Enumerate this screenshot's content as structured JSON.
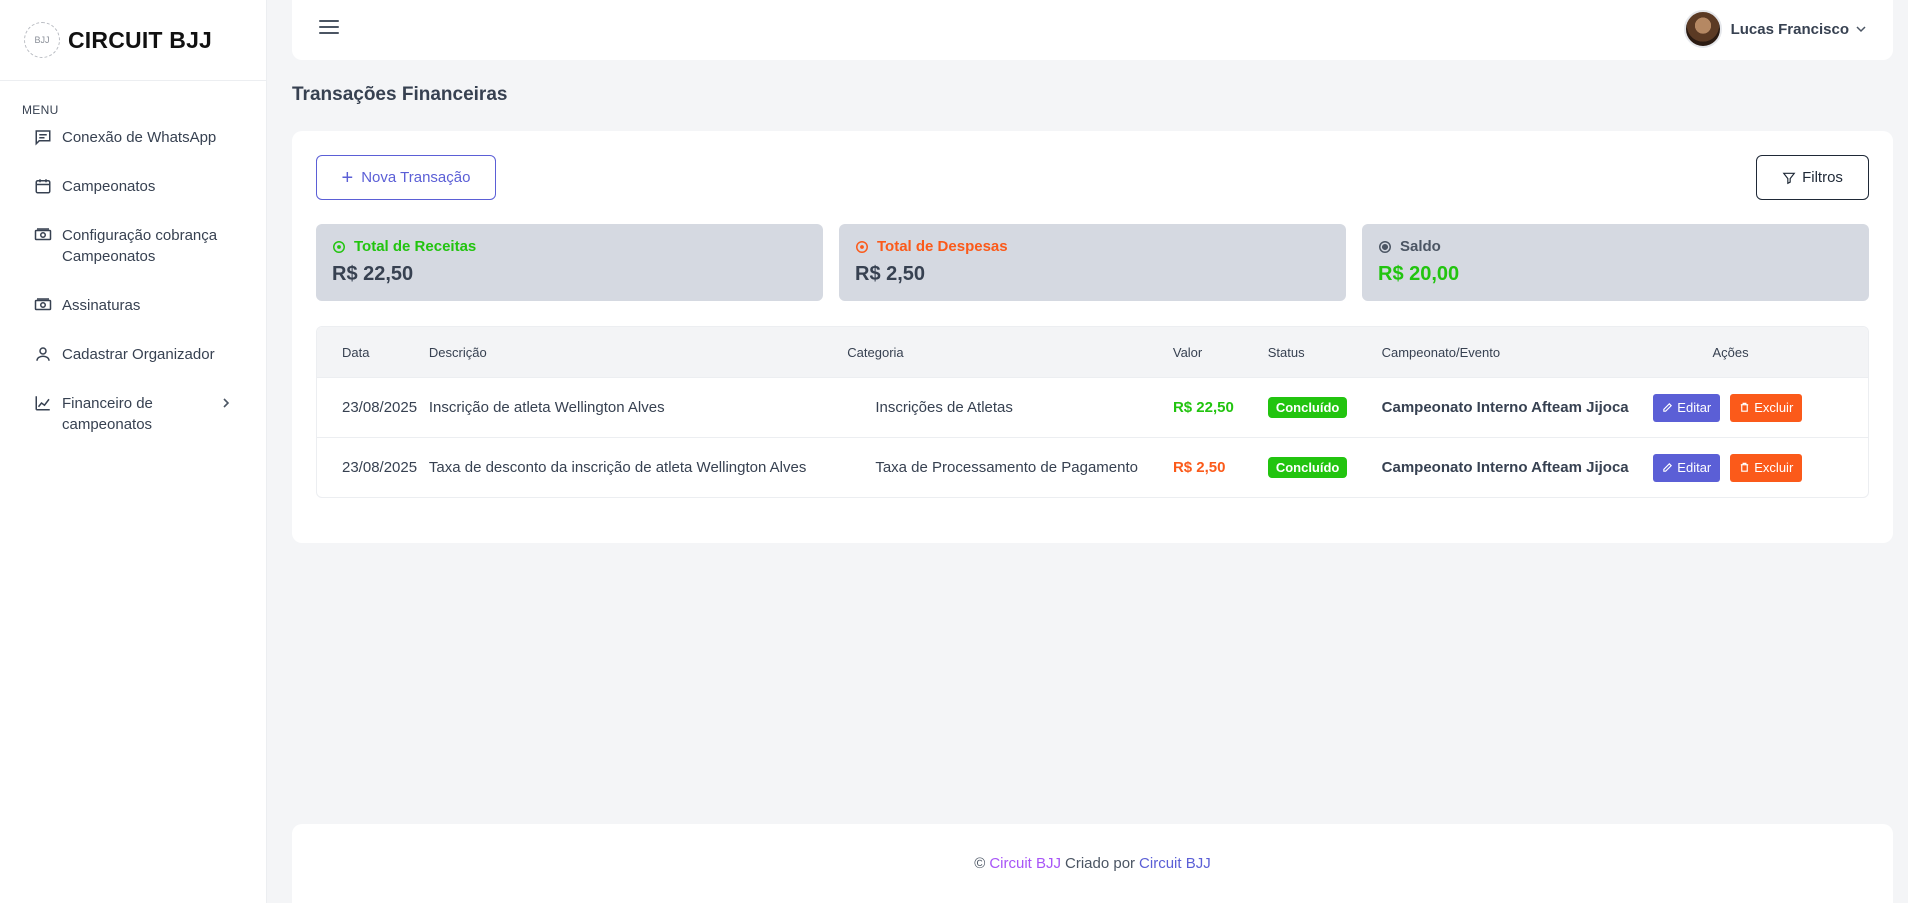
{
  "brand": {
    "logo_text": "BJJ",
    "name": "CIRCUIT BJJ"
  },
  "sidebar": {
    "heading": "MENU",
    "items": [
      {
        "label": "Conexão de WhatsApp",
        "icon": "message-icon"
      },
      {
        "label": "Campeonatos",
        "icon": "calendar-icon"
      },
      {
        "label": "Configuração cobrança Campeonatos",
        "icon": "money-icon"
      },
      {
        "label": "Assinaturas",
        "icon": "money-icon"
      },
      {
        "label": "Cadastrar Organizador",
        "icon": "user-icon"
      },
      {
        "label": "Financeiro de campeonatos",
        "icon": "chart-icon"
      }
    ]
  },
  "header": {
    "user_name": "Lucas Francisco"
  },
  "page": {
    "title": "Transações Financeiras"
  },
  "toolbar": {
    "new_label": "Nova Transação",
    "filter_label": "Filtros"
  },
  "summary": {
    "receitas": {
      "title": "Total de Receitas",
      "value": "R$ 22,50"
    },
    "despesas": {
      "title": "Total de Despesas",
      "value": "R$ 2,50"
    },
    "saldo": {
      "title": "Saldo",
      "value": "R$ 20,00"
    }
  },
  "colors": {
    "accent": "#5b5fd6",
    "positive": "#22c40f",
    "negative": "#fb5a1a",
    "card_bg": "#d5d9e1"
  },
  "table": {
    "headers": {
      "data": "Data",
      "desc": "Descrição",
      "cat": "Categoria",
      "valor": "Valor",
      "status": "Status",
      "camp": "Campeonato/Evento",
      "acoes": "Ações"
    },
    "rows": [
      {
        "data": "23/08/2025",
        "desc": "Inscrição de atleta Wellington Alves",
        "cat": "Inscrições de Atletas",
        "valor": "R$ 22,50",
        "status": "Concluído",
        "camp": "Campeonato Interno Afteam Jijoca",
        "edit": "Editar",
        "del": "Excluir"
      },
      {
        "data": "23/08/2025",
        "desc": "Taxa de desconto da inscrição de atleta Wellington Alves",
        "cat": "Taxa de Processamento de Pagamento",
        "valor": "R$ 2,50",
        "status": "Concluído",
        "camp": "Campeonato Interno Afteam Jijoca",
        "edit": "Editar",
        "del": "Excluir"
      }
    ]
  },
  "footer": {
    "copyright": "©",
    "brand1": "Circuit BJJ",
    "middle": "Criado por",
    "brand2": "Circuit BJJ"
  }
}
